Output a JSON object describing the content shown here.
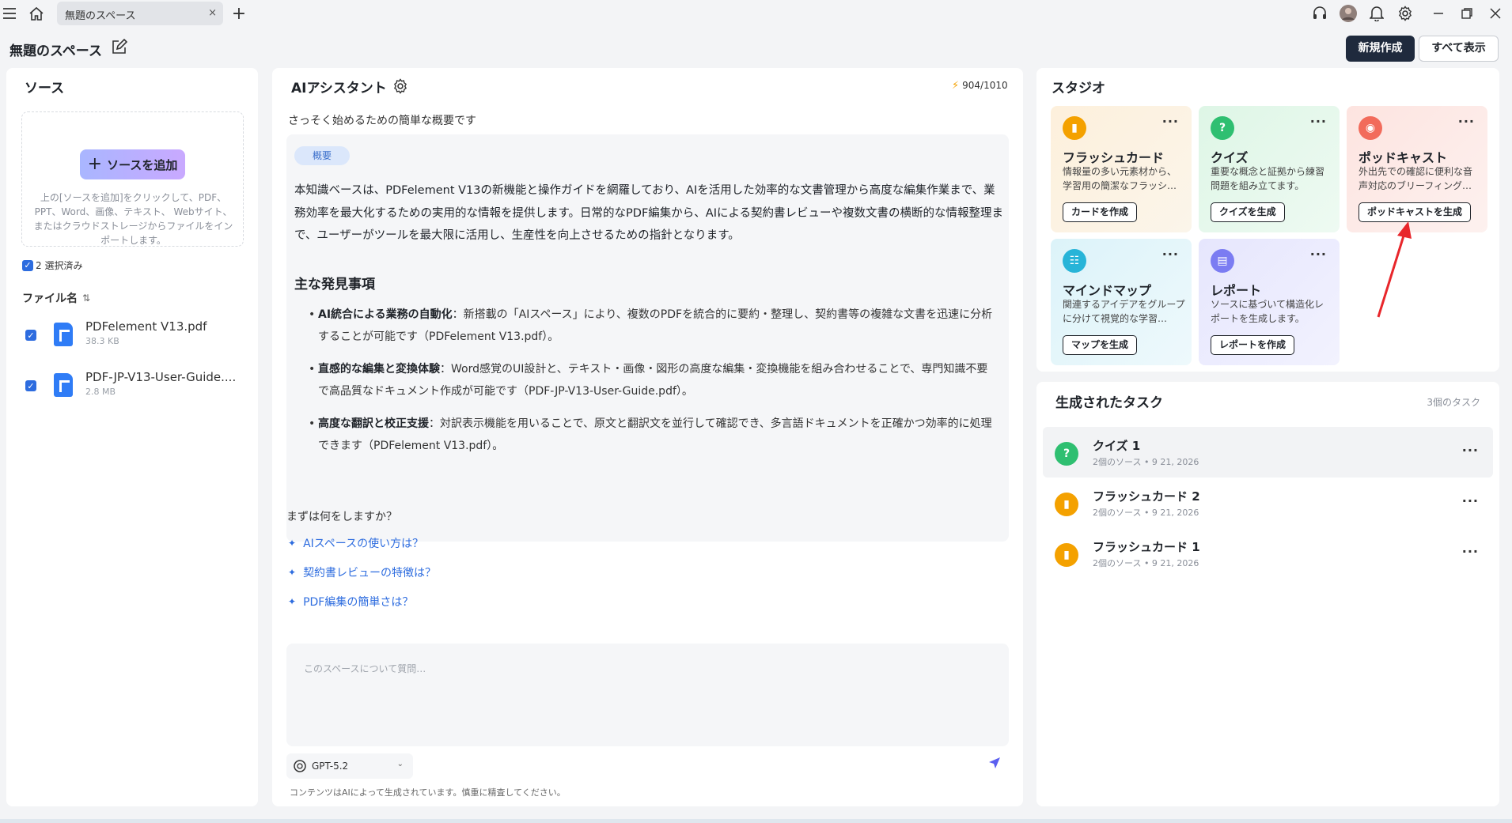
{
  "topbar": {
    "tab_title": "無題のスペース",
    "tab_close": "×",
    "new_tab": "+"
  },
  "header": {
    "space_title": "無題のスペース",
    "new_button": "新規作成",
    "view_all_button": "すべて表示"
  },
  "sources": {
    "title": "ソース",
    "add_button": "ソースを追加",
    "hint": "上の[ソースを追加]をクリックして、PDF、PPT、Word、画像、テキスト、 Webサイト、またはクラウドストレージからファイルをインポートします。",
    "selected_label": "2 選択済み",
    "file_header": "ファイル名",
    "files": [
      {
        "name": "PDFelement V13.pdf",
        "size": "38.3 KB"
      },
      {
        "name": "PDF-JP-V13-User-Guide....",
        "size": "2.8 MB"
      }
    ]
  },
  "assistant": {
    "title": "AIアシスタント",
    "credits": "904/1010",
    "intro": "さっそく始めるための簡単な概要です",
    "summary_pill": "概要",
    "summary": "本知識ベースは、PDFelement V13の新機能と操作ガイドを網羅しており、AIを活用した効率的な文書管理から高度な編集作業まで、業務効率を最大化するための実用的な情報を提供します。日常的なPDF編集から、AIによる契約書レビューや複数文書の横断的な情報整理まで、ユーザーがツールを最大限に活用し、生産性を向上させるための指針となります。",
    "findings_title": "主な発見事項",
    "findings": [
      {
        "label": "AI統合による業務の自動化",
        "text": "：新搭載の「AIスペース」により、複数のPDFを統合的に要約・整理し、契約書等の複雑な文書を迅速に分析することが可能です（PDFelement V13.pdf）。"
      },
      {
        "label": "直感的な編集と変換体験",
        "text": "：Word感覚のUI設計と、テキスト・画像・図形の高度な編集・変換機能を組み合わせることで、専門知識不要で高品質なドキュメント作成が可能です（PDF-JP-V13-User-Guide.pdf）。"
      },
      {
        "label": "高度な翻訳と校正支援",
        "text": "：対訳表示機能を用いることで、原文と翻訳文を並行して確認でき、多言語ドキュメントを正確かつ効率的に処理できます（PDFelement V13.pdf）。"
      }
    ],
    "question_title": "まずは何をしますか？",
    "suggestions": [
      "AIスペースの使い方は？",
      "契約書レビューの特徴は？",
      "PDF編集の簡単さは？"
    ],
    "input_placeholder": "このスペースについて質問…",
    "model": "GPT-5.2",
    "disclaimer": "コンテンツはAIによって生成されています。慎重に精査してください。"
  },
  "studio": {
    "title": "スタジオ",
    "cards": [
      {
        "title": "フラッシュカード",
        "desc": "情報量の多い元素材から、学習用の簡潔なフラッシ…",
        "button": "カードを作成",
        "color": "#f4a100",
        "bg": "linear-gradient(135deg,#fdf0dc,#fbf5ea)",
        "icon": "flashcard-icon"
      },
      {
        "title": "クイズ",
        "desc": "重要な概念と証拠から練習問題を組み立てます。",
        "button": "クイズを生成",
        "color": "#2fbf71",
        "bg": "linear-gradient(135deg,#def6e6,#eefaf2)",
        "icon": "quiz-icon"
      },
      {
        "title": "ポッドキャスト",
        "desc": "外出先での確認に便利な音声対応のブリーフィング…",
        "button": "ポッドキャストを生成",
        "color": "#f26b5b",
        "bg": "linear-gradient(135deg,#fde4e0,#fdf1ef)",
        "icon": "podcast-icon"
      },
      {
        "title": "マインドマップ",
        "desc": "関連するアイデアをグループに分けて視覚的な学習…",
        "button": "マップを生成",
        "color": "#27b4d8",
        "bg": "linear-gradient(135deg,#dcf3f9,#eef9fc)",
        "icon": "mindmap-icon"
      },
      {
        "title": "レポート",
        "desc": "ソースに基づいて構造化レポートを生成します。",
        "button": "レポートを作成",
        "color": "#7b7cf2",
        "bg": "linear-gradient(135deg,#e6e6fd,#f2f2fe)",
        "icon": "report-icon"
      }
    ]
  },
  "tasks": {
    "title": "生成されたタスク",
    "count": "3個のタスク",
    "items": [
      {
        "name": "クイズ 1",
        "meta": "2個のソース • 9 21, 2026",
        "color": "#2fbf71",
        "icon": "quiz-icon"
      },
      {
        "name": "フラッシュカード 2",
        "meta": "2個のソース • 9 21, 2026",
        "color": "#f4a100",
        "icon": "flashcard-icon"
      },
      {
        "name": "フラッシュカード 1",
        "meta": "2個のソース • 9 21, 2026",
        "color": "#f4a100",
        "icon": "flashcard-icon"
      }
    ]
  }
}
